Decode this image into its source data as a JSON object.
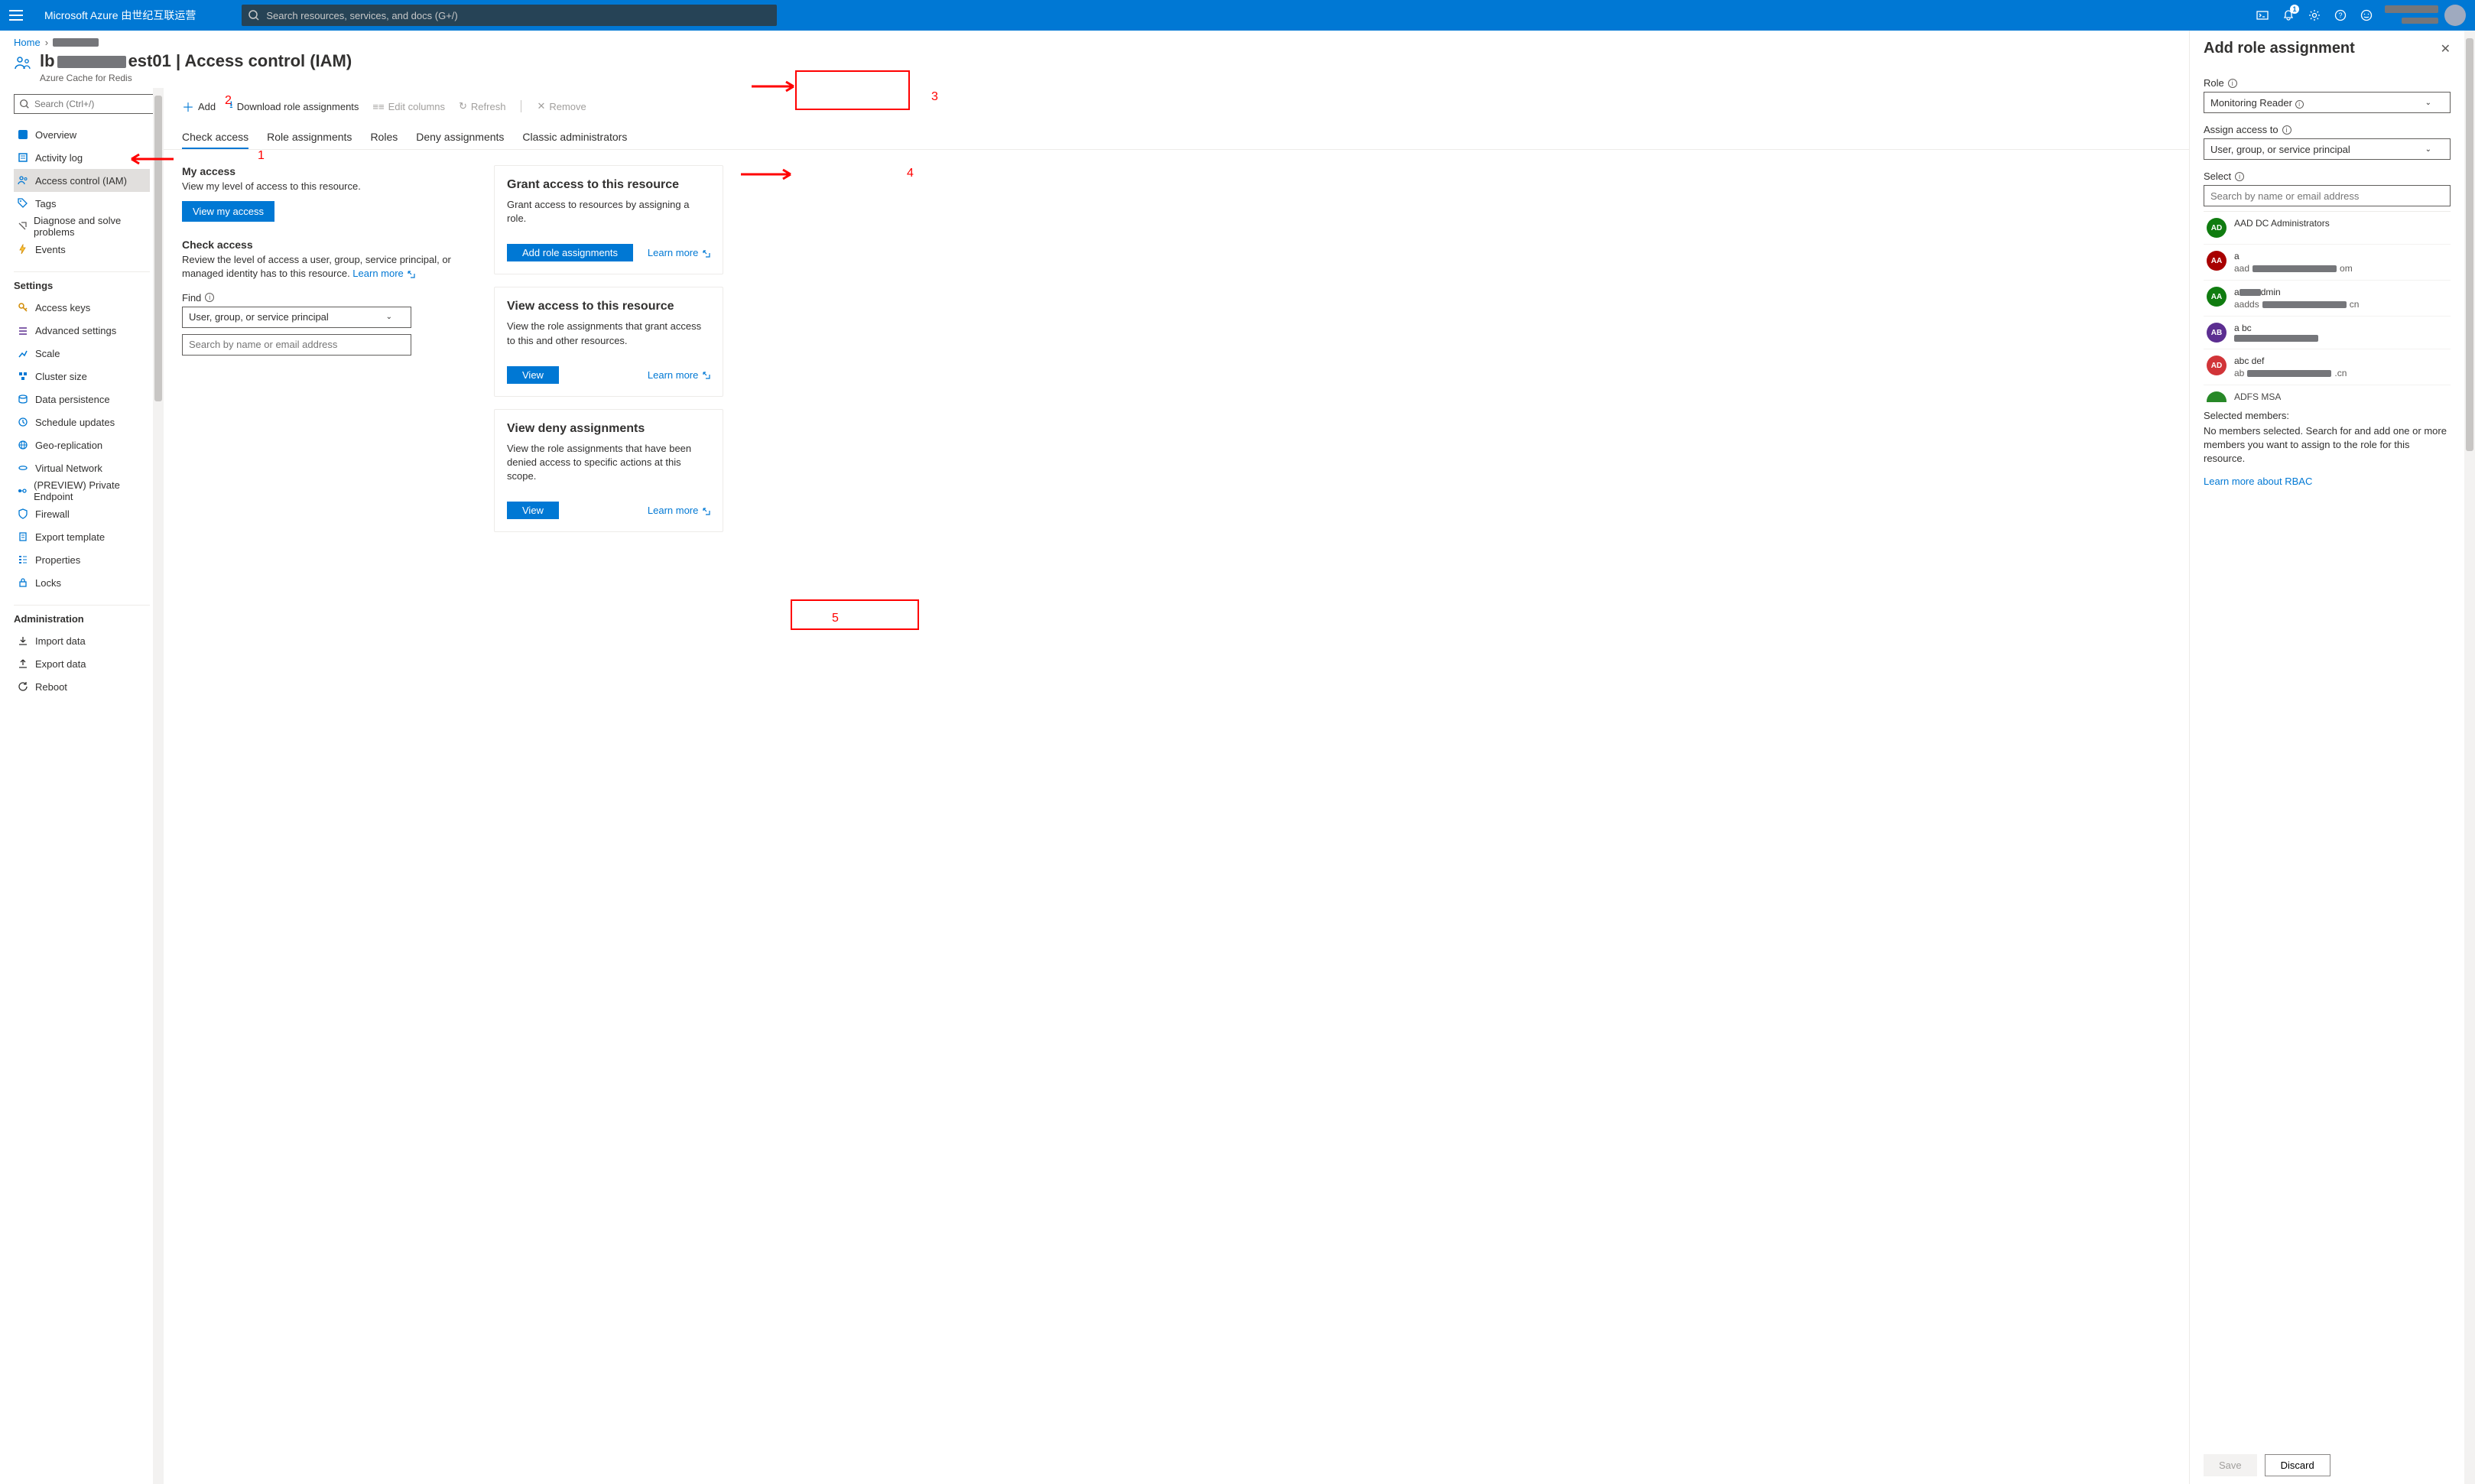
{
  "topbar": {
    "brand": "Microsoft Azure 由世纪互联运营",
    "search_placeholder": "Search resources, services, and docs (G+/)",
    "notification_count": "1"
  },
  "breadcrumb": {
    "home": "Home",
    "resource_redacted": "████████"
  },
  "header": {
    "title_prefix": "lb",
    "title_suffix": "est01  |  Access control (IAM)",
    "subtitle": "Azure Cache for Redis"
  },
  "sidesearch": {
    "placeholder": "Search (Ctrl+/)"
  },
  "sidebar": {
    "items": [
      {
        "label": "Overview",
        "icon": "overview"
      },
      {
        "label": "Activity log",
        "icon": "activitylog"
      },
      {
        "label": "Access control (IAM)",
        "icon": "iam",
        "active": true
      },
      {
        "label": "Tags",
        "icon": "tags"
      },
      {
        "label": "Diagnose and solve problems",
        "icon": "diagnose"
      },
      {
        "label": "Events",
        "icon": "events"
      }
    ],
    "settings_heading": "Settings",
    "settings": [
      {
        "label": "Access keys",
        "icon": "key"
      },
      {
        "label": "Advanced settings",
        "icon": "advanced"
      },
      {
        "label": "Scale",
        "icon": "scale"
      },
      {
        "label": "Cluster size",
        "icon": "cluster"
      },
      {
        "label": "Data persistence",
        "icon": "persistence"
      },
      {
        "label": "Schedule updates",
        "icon": "schedule"
      },
      {
        "label": "Geo-replication",
        "icon": "geo"
      },
      {
        "label": "Virtual Network",
        "icon": "vnet"
      },
      {
        "label": "(PREVIEW) Private Endpoint",
        "icon": "endpoint"
      },
      {
        "label": "Firewall",
        "icon": "firewall"
      },
      {
        "label": "Export template",
        "icon": "export"
      },
      {
        "label": "Properties",
        "icon": "properties"
      },
      {
        "label": "Locks",
        "icon": "locks"
      }
    ],
    "admin_heading": "Administration",
    "admin": [
      {
        "label": "Import data",
        "icon": "import"
      },
      {
        "label": "Export data",
        "icon": "exportdata"
      },
      {
        "label": "Reboot",
        "icon": "reboot"
      }
    ]
  },
  "toolbar": {
    "add": "Add",
    "download": "Download role assignments",
    "edit_columns": "Edit columns",
    "refresh": "Refresh",
    "remove": "Remove"
  },
  "tabs": {
    "check_access": "Check access",
    "role_assignments": "Role assignments",
    "roles": "Roles",
    "deny_assignments": "Deny assignments",
    "classic_admins": "Classic administrators"
  },
  "left_col": {
    "my_access_h": "My access",
    "my_access_p": "View my level of access to this resource.",
    "view_my_access_btn": "View my access",
    "check_access_h": "Check access",
    "check_access_p": "Review the level of access a user, group, service principal, or managed identity has to this resource. ",
    "learn_more": "Learn more",
    "find_label": "Find",
    "find_select": "User, group, or service principal",
    "find_input_placeholder": "Search by name or email address"
  },
  "cards": {
    "grant": {
      "title": "Grant access to this resource",
      "desc": "Grant access to resources by assigning a role.",
      "btn": "Add role assignments",
      "link": "Learn more"
    },
    "view_access": {
      "title": "View access to this resource",
      "desc": "View the role assignments that grant access to this and other resources.",
      "btn": "View",
      "link": "Learn more"
    },
    "view_deny": {
      "title": "View deny assignments",
      "desc": "View the role assignments that have been denied access to specific actions at this scope.",
      "btn": "View",
      "link": "Learn more"
    }
  },
  "blade": {
    "title": "Add role assignment",
    "role_label": "Role",
    "role_value": "Monitoring Reader",
    "assign_label": "Assign access to",
    "assign_value": "User, group, or service principal",
    "select_label": "Select",
    "select_placeholder": "Search by name or email address",
    "principals": [
      {
        "initials": "AD",
        "color": "green",
        "name": "AAD DC Administrators",
        "sub": ""
      },
      {
        "initials": "AA",
        "color": "red-a",
        "name": "a",
        "sub_prefix": "aad",
        "sub_suffix": "om",
        "redact": true
      },
      {
        "initials": "AA",
        "color": "green",
        "name_prefix": "a",
        "name_suffix": "dmin",
        "sub_prefix": "aadds",
        "sub_suffix": "cn",
        "redact": true,
        "name_redact": true
      },
      {
        "initials": "AB",
        "color": "purple",
        "name": "a bc",
        "sub_prefix": "",
        "sub_suffix": "",
        "redact": true
      },
      {
        "initials": "AD",
        "color": "red-d",
        "name": "abc def",
        "sub_prefix": "ab",
        "sub_suffix": ".cn",
        "redact": true
      },
      {
        "initials": "",
        "color": "green",
        "name": "ADFS MSA",
        "sub": "",
        "partial": true
      }
    ],
    "selected_label": "Selected members:",
    "selected_desc": "No members selected. Search for and add one or more members you want to assign to the role for this resource.",
    "learn_rbac": "Learn more about RBAC",
    "save": "Save",
    "discard": "Discard"
  },
  "annotations": {
    "n1": "1",
    "n2": "2",
    "n3": "3",
    "n4": "4",
    "n5": "5"
  }
}
